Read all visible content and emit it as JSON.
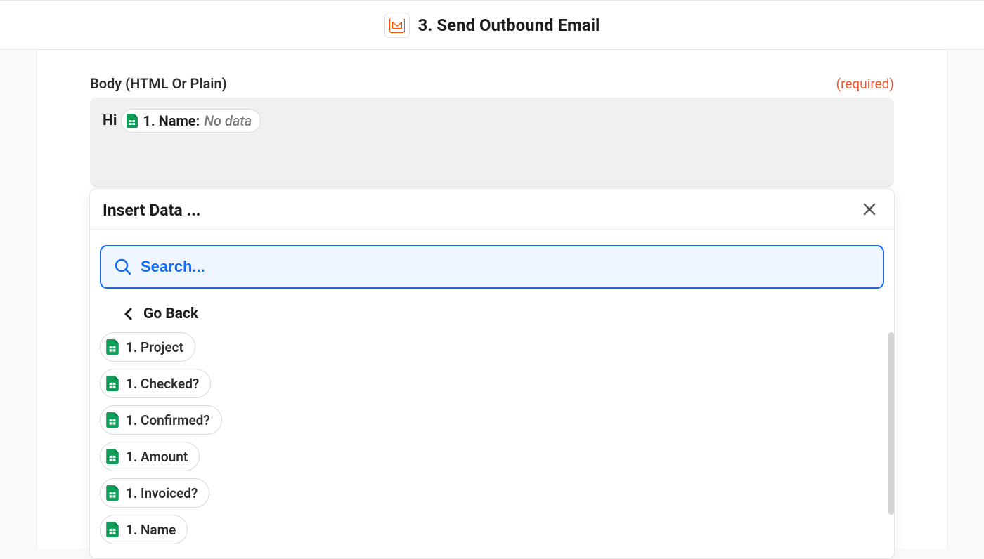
{
  "header": {
    "title": "3. Send Outbound Email"
  },
  "field": {
    "label": "Body (HTML Or Plain)",
    "required_label": "(required)"
  },
  "body": {
    "text_prefix": "Hi",
    "pill_label": "1. Name:",
    "pill_value": "No data"
  },
  "popover": {
    "title": "Insert Data ...",
    "search_placeholder": "Search...",
    "go_back_label": "Go Back",
    "items": [
      {
        "label": "1. Project"
      },
      {
        "label": "1. Checked?"
      },
      {
        "label": "1. Confirmed?"
      },
      {
        "label": "1. Amount"
      },
      {
        "label": "1. Invoiced?"
      },
      {
        "label": "1. Name"
      }
    ]
  }
}
